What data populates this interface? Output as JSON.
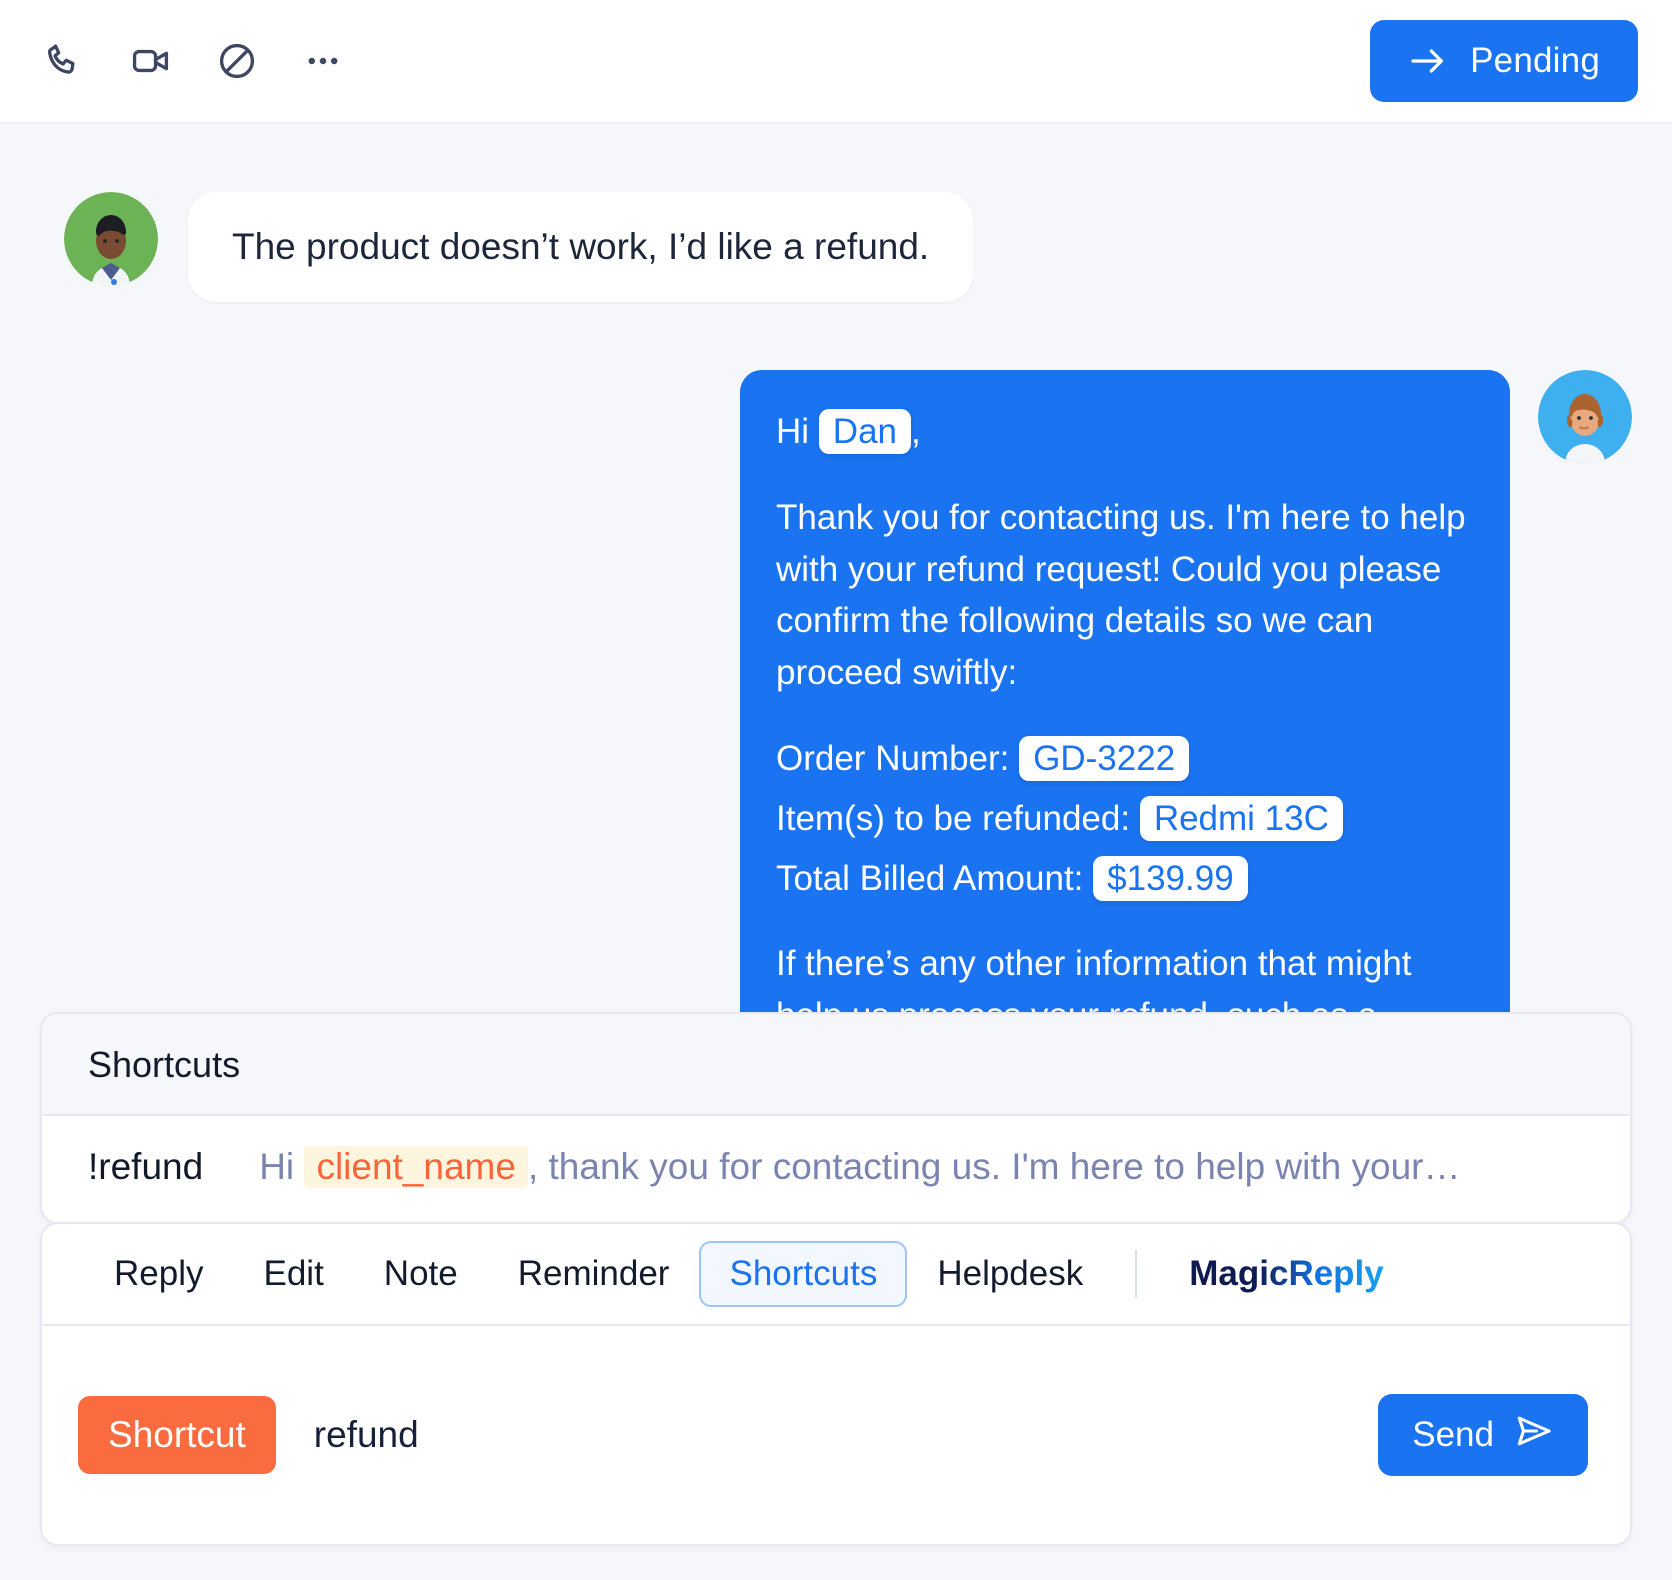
{
  "header": {
    "icons": [
      {
        "name": "phone-icon",
        "label": "Call"
      },
      {
        "name": "video-icon",
        "label": "Video call"
      },
      {
        "name": "block-icon",
        "label": "Block"
      },
      {
        "name": "more-icon",
        "label": "More"
      }
    ],
    "status_button": {
      "label": "Pending",
      "icon": "arrow-right-icon",
      "color": "#1a73f0"
    }
  },
  "conversation": {
    "incoming": {
      "text": "The product doesn’t work, I’d like a refund.",
      "avatar": "customer-avatar"
    },
    "outgoing": {
      "avatar": "agent-avatar",
      "greeting_prefix": "Hi",
      "greeting_name": "Dan",
      "greeting_suffix": ",",
      "paragraph1": "Thank you for contacting us. I'm here to help with your refund request! Could you please confirm the following details so we can proceed swiftly:",
      "details": [
        {
          "label": "Order Number:",
          "value": "GD-3222"
        },
        {
          "label": "Item(s) to be refunded:",
          "value": "Redmi 13C"
        },
        {
          "label": "Total Billed Amount:",
          "value": "$139.99"
        }
      ],
      "paragraph2": "If there’s any other information that might help us process your refund, such as a"
    }
  },
  "shortcuts_panel": {
    "title": "Shortcuts",
    "items": [
      {
        "key": "!refund",
        "preview_prefix": "Hi",
        "preview_variable": "client_name",
        "preview_suffix": ", thank you for contacting us. I'm here to help with your…"
      }
    ]
  },
  "composer": {
    "tabs": [
      {
        "label": "Reply",
        "active": false,
        "name": "tab-reply"
      },
      {
        "label": "Edit",
        "active": false,
        "name": "tab-edit"
      },
      {
        "label": "Note",
        "active": false,
        "name": "tab-note"
      },
      {
        "label": "Reminder",
        "active": false,
        "name": "tab-reminder"
      },
      {
        "label": "Shortcuts",
        "active": true,
        "name": "tab-shortcuts"
      },
      {
        "label": "Helpdesk",
        "active": false,
        "name": "tab-helpdesk"
      }
    ],
    "magic_tab": {
      "label": "MagicReply",
      "name": "tab-magicreply"
    },
    "badge": "Shortcut",
    "value": "refund",
    "send_label": "Send",
    "send_icon": "paper-plane-icon"
  },
  "colors": {
    "accent_blue": "#1a73f0",
    "orange": "#fa6b3f",
    "variable_orange": "#f9643b",
    "variable_bg": "#fdf5dd",
    "muted_text": "#7b84b0",
    "page_bg": "#f6f7fb"
  }
}
